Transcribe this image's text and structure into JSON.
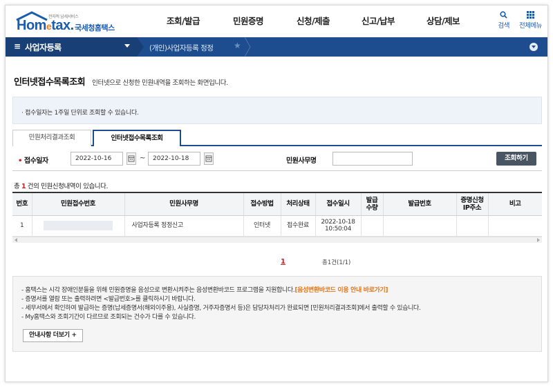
{
  "header": {
    "logo": {
      "small_text": "전자적 납세서비스",
      "home": "Hom",
      "e": "e",
      "tax": "tax.",
      "korean": "국세청홈택스"
    },
    "gnb": [
      "조회/발급",
      "민원증명",
      "신청/제출",
      "신고/납부",
      "상담/제보"
    ],
    "util": {
      "search": "검색",
      "all_menu": "전체메뉴"
    }
  },
  "navbar": {
    "menu_label": "사업자등록",
    "breadcrumb": "(개인)사업자등록 정정"
  },
  "page": {
    "title": "인터넷접수목록조회",
    "description": "인터넷으로 신청한 민원내역을 조회하는 화면입니다.",
    "notice": "· 접수일자는 1주일 단위로 조회할 수 있습니다."
  },
  "tabs": [
    {
      "label": "민원처리결과조회",
      "active": false
    },
    {
      "label": "인터넷접수목록조회",
      "active": true
    }
  ],
  "search": {
    "date_label": "접수일자",
    "date_from": "2022-10-16",
    "date_to": "2022-10-18",
    "name_label": "민원사무명",
    "name_value": "",
    "button": "조회하기"
  },
  "result": {
    "prefix": "총 ",
    "count": "1",
    "suffix": " 건의 민원신청내역이 있습니다."
  },
  "table": {
    "columns": [
      "번호",
      "민원접수번호",
      "민원사무명",
      "접수방법",
      "처리상태",
      "접수일시",
      "발급\n수량",
      "발급번호",
      "증명신청\nIP주소",
      "비고"
    ],
    "rows": [
      {
        "no": "1",
        "receipt_no": "",
        "name": "사업자등록 정정신고",
        "method": "인터넷",
        "status": "접수완료",
        "date": "2022-10-18",
        "time": "10:50:04",
        "qty": "",
        "issue_no": "",
        "ip": "",
        "note": ""
      }
    ]
  },
  "pager": {
    "current": "1",
    "total": "총1건(1/1)"
  },
  "guide": {
    "line1": "- 홈택스는 시각 장애인분들을 위해 민원증명을 음성으로 변환시켜주는 음성변환바코드 프로그램을 지원합니다.",
    "line1_link": "[음성변환바코드 이용 안내 바로가기]",
    "line2": "- 증명서를 열람 또는 출력하려면 <발급번호>를 클릭하시기 바랍니다.",
    "line3": "- 세무서에서 확인하여 발급하는 증명(납세증명서(해외이주용), 사실증명, 거주자증명서 등)은 담당자처리가 완료되면 [민원처리결과조회]에서 출력할 수 있습니다.",
    "line4": "- My홈택스와 조회기간이 다르므로 조회되는 건수가 다를 수 있습니다.",
    "more_button": "안내사항 더보기 +"
  },
  "colors": {
    "navy": "#1d4d8e",
    "accent_red": "#c52020",
    "link_orange": "#e0771a",
    "logo_blue": "#1a5cb0"
  }
}
